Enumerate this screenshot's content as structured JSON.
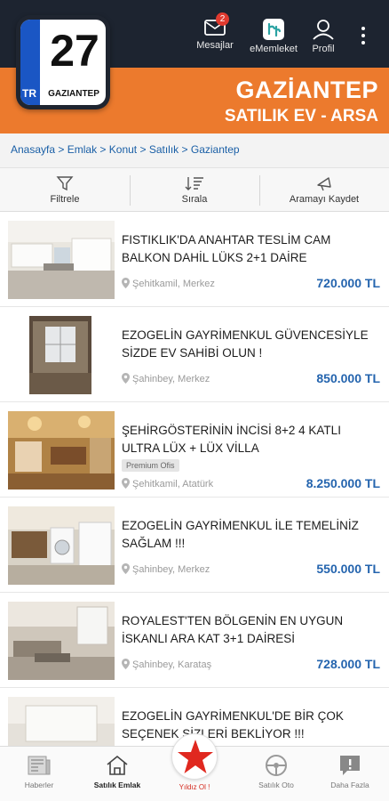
{
  "header": {
    "plate_number": "27",
    "plate_country": "TR",
    "plate_city": "GAZIANTEP",
    "messages_label": "Mesajlar",
    "messages_badge": "2",
    "ememleket_label": "eMemleket",
    "profile_label": "Profil",
    "city_title": "GAZİANTEP",
    "city_subtitle": "SATILIK EV - ARSA"
  },
  "breadcrumb": [
    "Anasayfa",
    "Emlak",
    "Konut",
    "Satılık",
    "Gaziantep"
  ],
  "toolbar": {
    "filter_label": "Filtrele",
    "sort_label": "Sırala",
    "save_label": "Aramayı Kaydet"
  },
  "listings": [
    {
      "title": "FISTIKLIK'DA ANAHTAR TESLİM CAM BALKON DAHİL LÜKS 2+1 DAİRE",
      "location": "Şehitkamil, Merkez",
      "price": "720.000 TL",
      "tag": ""
    },
    {
      "title": "EZOGELİN GAYRİMENKUL GÜVENCESİYLE SİZDE EV SAHİBİ OLUN !",
      "location": "Şahinbey, Merkez",
      "price": "850.000 TL",
      "tag": ""
    },
    {
      "title": "ŞEHİRGÖSTERİNİN İNCİSİ 8+2 4 KATLI ULTRA LÜX + LÜX VİLLA",
      "location": "Şehitkamil, Atatürk",
      "price": "8.250.000 TL",
      "tag": "Premium Ofis"
    },
    {
      "title": "EZOGELİN GAYRİMENKUL İLE TEMELİNİZ SAĞLAM !!!",
      "location": "Şahinbey, Merkez",
      "price": "550.000 TL",
      "tag": ""
    },
    {
      "title": "ROYALEST'TEN BÖLGENİN EN UYGUN İSKANLI ARA KAT 3+1 DAİRESİ",
      "location": "Şahinbey, Karataş",
      "price": "728.000 TL",
      "tag": ""
    },
    {
      "title": "EZOGELİN GAYRİMENKUL'DE BİR ÇOK SEÇENEK SİZLERİ BEKLİYOR !!!",
      "location": "",
      "price": "",
      "tag": ""
    }
  ],
  "bottom_nav": {
    "news": "Haberler",
    "realestate": "Satılık Emlak",
    "yildiz": "Yıldız Ol !",
    "auto": "Satılık Oto",
    "more": "Daha Fazla"
  },
  "colors": {
    "header_dark": "#1d2430",
    "accent_orange": "#ec7a2d",
    "price_blue": "#2464ae",
    "star_red": "#d42a1f"
  }
}
